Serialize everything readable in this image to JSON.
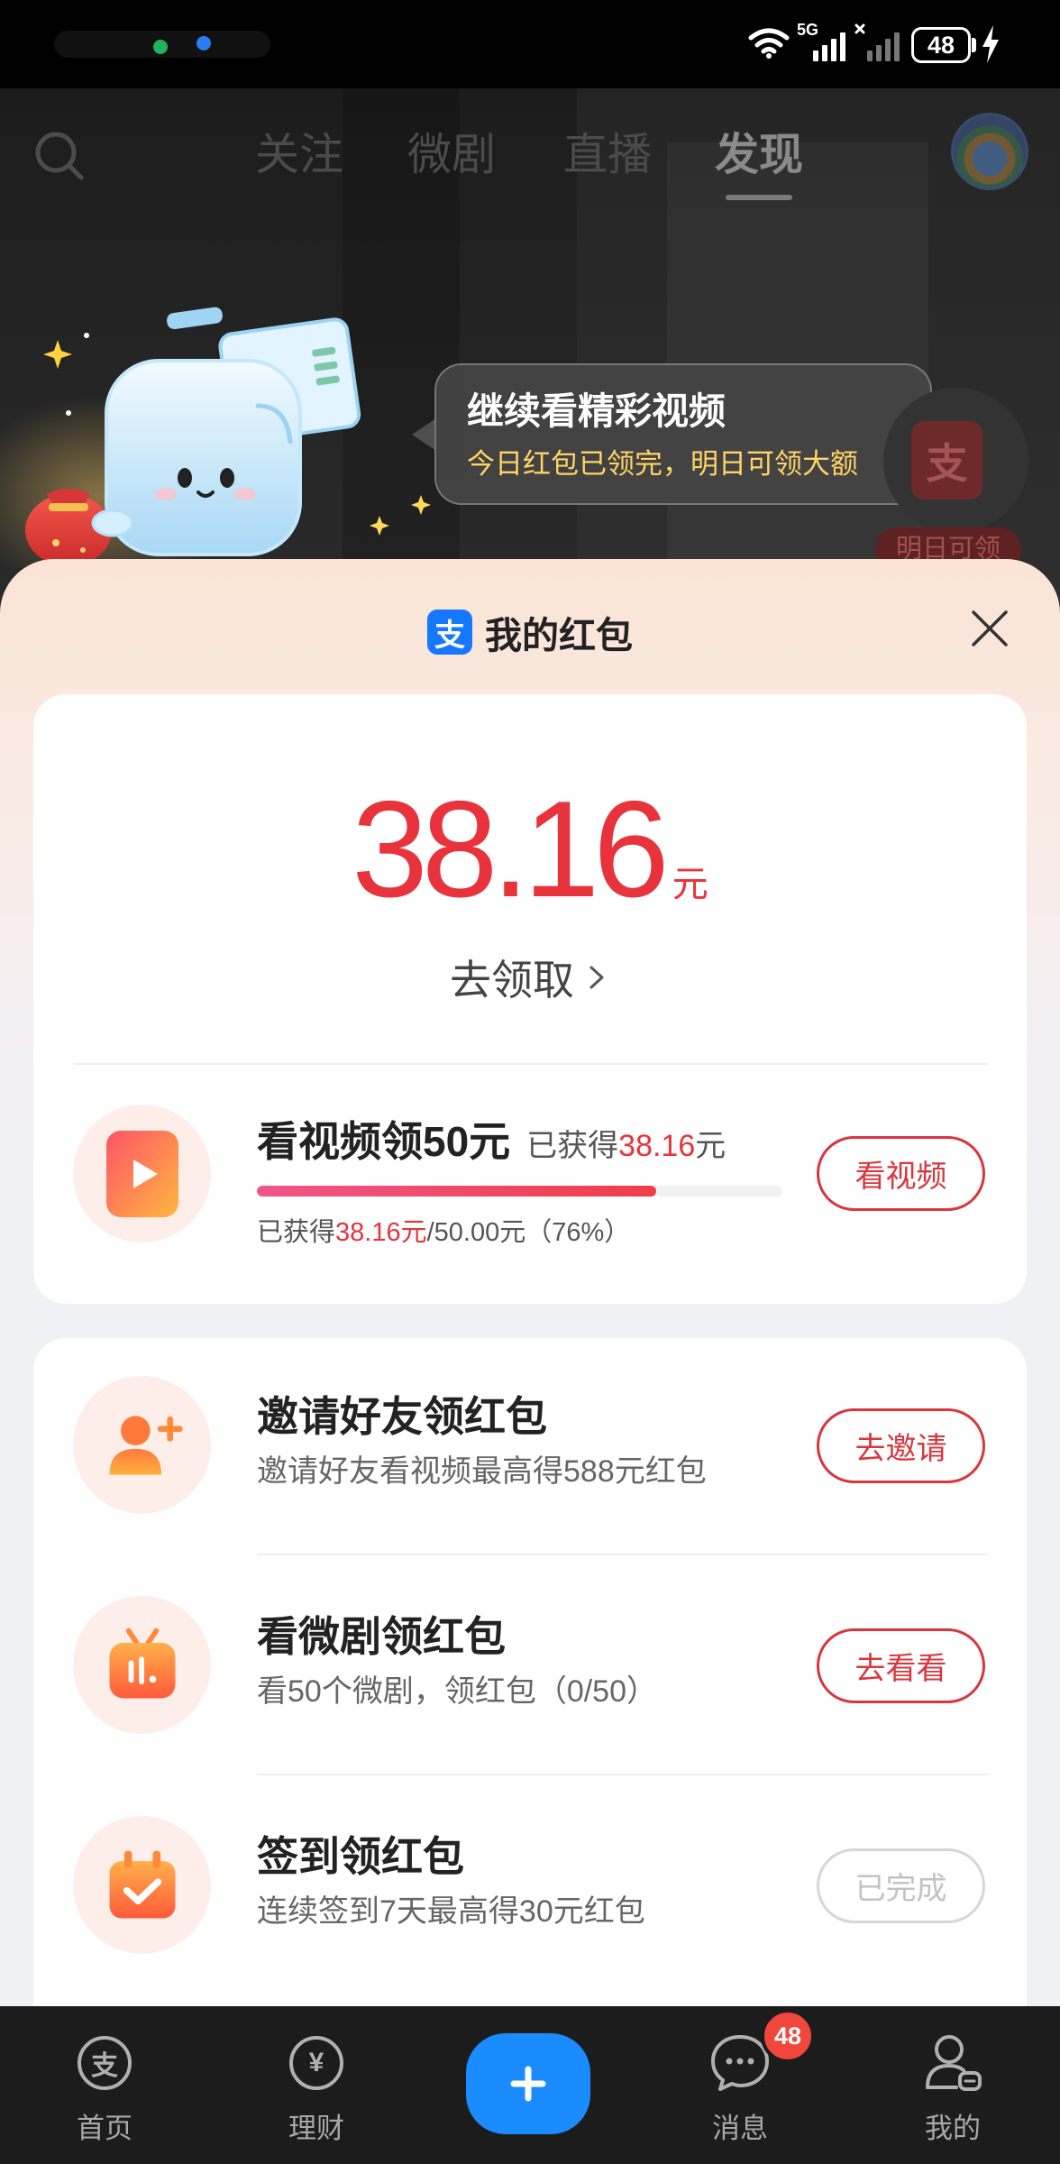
{
  "status_bar": {
    "network": "5G",
    "battery": "48"
  },
  "top_nav": {
    "tabs": [
      {
        "label": "关注",
        "active": false
      },
      {
        "label": "微剧",
        "active": false
      },
      {
        "label": "直播",
        "active": false
      },
      {
        "label": "发现",
        "active": true
      }
    ]
  },
  "promo_bubble": {
    "title": "继续看精彩视频",
    "subtitle": "今日红包已领完，明日可领大额"
  },
  "side_widget": {
    "icon_text": "支",
    "badge": "明日可领"
  },
  "sheet": {
    "logo_text": "支",
    "title": "我的红包",
    "balance": {
      "amount": "38.16",
      "unit": "元",
      "claim_label": "去领取"
    },
    "video_task": {
      "title": "看视频领50元",
      "earned_label": "已获得",
      "earned_amount": "38.16",
      "earned_unit": "元",
      "progress": 0.76,
      "progress_prefix": "已获得",
      "progress_current": "38.16元",
      "progress_rest": "/50.00元（76%）",
      "button": "看视频",
      "icon": "play-icon"
    },
    "tasks": [
      {
        "title": "邀请好友领红包",
        "subtitle": "邀请好友看视频最高得588元红包",
        "button": "去邀请",
        "done": false,
        "icon": "invite-friend-icon"
      },
      {
        "title": "看微剧领红包",
        "subtitle": "看50个微剧，领红包（0/50）",
        "button": "去看看",
        "done": false,
        "icon": "tv-drama-icon"
      },
      {
        "title": "签到领红包",
        "subtitle": "连续签到7天最高得30元红包",
        "button": "已完成",
        "done": true,
        "icon": "calendar-check-icon"
      }
    ]
  },
  "tab_bar": {
    "items": [
      {
        "label": "首页",
        "glyph": "支",
        "icon": "alipay-home-icon"
      },
      {
        "label": "理财",
        "glyph": "¥",
        "icon": "wealth-icon"
      },
      {
        "icon": "plus-icon"
      },
      {
        "label": "消息",
        "icon": "message-icon",
        "badge": "48"
      },
      {
        "label": "我的",
        "icon": "profile-icon"
      }
    ]
  },
  "colors": {
    "accent": "#e8333c",
    "accent_line": "#d9363e",
    "bubble_subtitle": "#ffd466",
    "alipay_blue": "#1677ff",
    "plus_blue": "#1a8cff",
    "badge": "#f0463c"
  }
}
